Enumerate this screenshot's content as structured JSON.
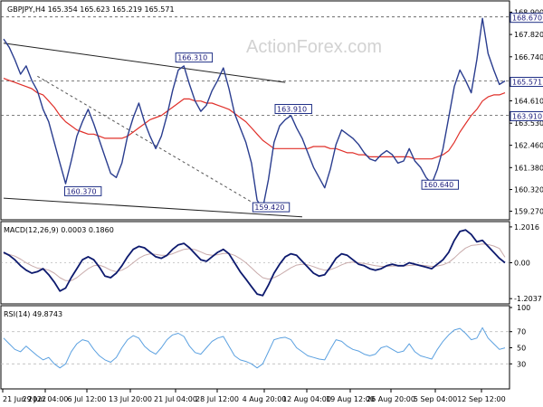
{
  "colors": {
    "bg": "#ffffff",
    "price": "#2a3d8f",
    "ma": "#e0302a",
    "macd": "#0d1a6e",
    "signal": "#c8aaaa",
    "rsi": "#5aa0e0",
    "grid": "#bdbdbd",
    "label_border": "#1f2f86",
    "watermark": "#d2d2d2"
  },
  "chart_data": [
    {
      "type": "line",
      "title": "GBPJPY,H4  165.354 165.623 165.219 165.571",
      "watermark": "ActionForex.com",
      "ylim": [
        158.9,
        169.4
      ],
      "yticks": [
        "168.900",
        "167.820",
        "166.740",
        "165.571",
        "164.610",
        "163.530",
        "162.460",
        "161.380",
        "160.320",
        "159.270"
      ],
      "key_levels": [
        "168.670",
        "165.571",
        "163.910"
      ],
      "series": [
        {
          "values": [
            167.6,
            167.2,
            166.6,
            165.9,
            166.3,
            165.6,
            165.1,
            164.2,
            163.6,
            162.6,
            161.6,
            160.6,
            161.7,
            162.9,
            163.6,
            164.2,
            163.5,
            162.7,
            161.9,
            161.1,
            160.9,
            161.6,
            162.9,
            163.8,
            164.5,
            163.6,
            162.9,
            162.3,
            162.9,
            163.9,
            165.1,
            166.1,
            166.3,
            165.4,
            164.6,
            164.1,
            164.4,
            165.1,
            165.6,
            166.2,
            165.2,
            164.0,
            163.3,
            162.6,
            161.6,
            159.8,
            159.4,
            160.8,
            162.6,
            163.4,
            163.7,
            163.9,
            163.3,
            162.8,
            162.1,
            161.4,
            160.9,
            160.4,
            161.3,
            162.5,
            163.2,
            163.0,
            162.8,
            162.5,
            162.1,
            161.8,
            161.7,
            162.0,
            162.2,
            162.0,
            161.6,
            161.7,
            162.3,
            161.7,
            161.4,
            160.9,
            160.6,
            161.3,
            162.3,
            163.8,
            165.3,
            166.1,
            165.6,
            165.0,
            166.6,
            168.6,
            166.9,
            166.1,
            165.4,
            165.571
          ],
          "labels": [
            "166.310",
            "163.910",
            "160.370",
            "159.420",
            "160.640"
          ]
        },
        {
          "name": "MA",
          "values": [
            165.7,
            165.6,
            165.5,
            165.4,
            165.3,
            165.2,
            165.0,
            164.9,
            164.6,
            164.3,
            163.9,
            163.6,
            163.4,
            163.2,
            163.1,
            163.0,
            163.0,
            162.9,
            162.8,
            162.8,
            162.8,
            162.8,
            162.9,
            163.1,
            163.3,
            163.5,
            163.7,
            163.8,
            163.9,
            164.1,
            164.3,
            164.5,
            164.7,
            164.7,
            164.6,
            164.6,
            164.5,
            164.5,
            164.4,
            164.3,
            164.2,
            164.0,
            163.8,
            163.6,
            163.3,
            163.0,
            162.7,
            162.5,
            162.3,
            162.3,
            162.3,
            162.3,
            162.3,
            162.3,
            162.3,
            162.4,
            162.4,
            162.4,
            162.3,
            162.3,
            162.2,
            162.1,
            162.1,
            162.0,
            162.0,
            161.9,
            161.9,
            161.9,
            161.9,
            161.9,
            161.9,
            161.9,
            161.9,
            161.8,
            161.8,
            161.8,
            161.8,
            161.9,
            162.0,
            162.2,
            162.6,
            163.1,
            163.5,
            163.9,
            164.2,
            164.6,
            164.8,
            164.9,
            164.9,
            165.0
          ]
        }
      ],
      "trendlines": [
        {
          "from": [
            0,
            167.4
          ],
          "to": [
            50,
            165.5
          ]
        },
        {
          "from": [
            0,
            159.9
          ],
          "to": [
            53,
            159.0
          ]
        },
        {
          "from": [
            6,
            165.8
          ],
          "to": [
            46,
            159.4
          ],
          "dashed": true
        }
      ],
      "x_tick_labels": [
        "21 Jun 2022",
        "29 Jun 04:00",
        "6 Jul 12:00",
        "13 Jul 20:00",
        "21 Jul 04:00",
        "28 Jul 12:00",
        "4 Aug 20:00",
        "12 Aug 04:00",
        "19 Aug 12:00",
        "26 Aug 20:00",
        "5 Sep 04:00",
        "12 Sep 12:00"
      ]
    },
    {
      "type": "line",
      "title": "MACD(12,26,9) 0.0003 0.1860",
      "ylim": [
        -1.35,
        1.35
      ],
      "yticks": [
        "1.2016",
        "0.00",
        "-1.2037"
      ],
      "series": [
        {
          "name": "MACD",
          "values": [
            0.35,
            0.25,
            0.1,
            -0.1,
            -0.25,
            -0.35,
            -0.3,
            -0.2,
            -0.4,
            -0.65,
            -0.95,
            -0.85,
            -0.5,
            -0.2,
            0.1,
            0.2,
            0.1,
            -0.15,
            -0.45,
            -0.5,
            -0.35,
            -0.1,
            0.2,
            0.45,
            0.55,
            0.5,
            0.35,
            0.2,
            0.15,
            0.25,
            0.45,
            0.6,
            0.65,
            0.5,
            0.3,
            0.1,
            0.05,
            0.2,
            0.35,
            0.45,
            0.3,
            0.0,
            -0.3,
            -0.55,
            -0.8,
            -1.05,
            -1.1,
            -0.75,
            -0.35,
            -0.05,
            0.2,
            0.3,
            0.25,
            0.05,
            -0.15,
            -0.35,
            -0.45,
            -0.4,
            -0.15,
            0.15,
            0.3,
            0.25,
            0.1,
            -0.05,
            -0.1,
            -0.2,
            -0.25,
            -0.2,
            -0.1,
            -0.05,
            -0.1,
            -0.1,
            0.0,
            -0.05,
            -0.1,
            -0.15,
            -0.2,
            -0.05,
            0.1,
            0.35,
            0.75,
            1.05,
            1.1,
            0.95,
            0.7,
            0.75,
            0.55,
            0.35,
            0.15,
            0.0003
          ]
        },
        {
          "name": "Signal",
          "values": [
            0.3,
            0.28,
            0.22,
            0.12,
            0.0,
            -0.1,
            -0.18,
            -0.2,
            -0.25,
            -0.35,
            -0.5,
            -0.6,
            -0.6,
            -0.5,
            -0.35,
            -0.2,
            -0.1,
            -0.08,
            -0.15,
            -0.25,
            -0.3,
            -0.25,
            -0.15,
            0.0,
            0.15,
            0.25,
            0.3,
            0.28,
            0.25,
            0.25,
            0.3,
            0.38,
            0.45,
            0.47,
            0.44,
            0.36,
            0.28,
            0.25,
            0.27,
            0.31,
            0.31,
            0.25,
            0.14,
            0.0,
            -0.17,
            -0.35,
            -0.5,
            -0.55,
            -0.5,
            -0.41,
            -0.29,
            -0.17,
            -0.08,
            -0.05,
            -0.07,
            -0.13,
            -0.2,
            -0.25,
            -0.23,
            -0.16,
            -0.07,
            0.0,
            0.02,
            0.0,
            -0.02,
            -0.06,
            -0.1,
            -0.12,
            -0.12,
            -0.11,
            -0.11,
            -0.11,
            -0.09,
            -0.08,
            -0.08,
            -0.1,
            -0.12,
            -0.11,
            -0.07,
            0.01,
            0.16,
            0.34,
            0.49,
            0.58,
            0.6,
            0.63,
            0.61,
            0.56,
            0.48,
            0.186
          ]
        }
      ]
    },
    {
      "type": "line",
      "title": "RSI(14) 49.8743",
      "ylim": [
        0,
        100
      ],
      "yticks": [
        "100",
        "70",
        "50",
        "30"
      ],
      "series": [
        {
          "name": "RSI",
          "values": [
            62,
            55,
            48,
            45,
            52,
            46,
            40,
            35,
            38,
            30,
            25,
            30,
            45,
            55,
            60,
            58,
            48,
            40,
            35,
            32,
            38,
            50,
            60,
            65,
            62,
            52,
            46,
            42,
            50,
            60,
            66,
            68,
            64,
            52,
            44,
            42,
            50,
            58,
            62,
            64,
            52,
            40,
            35,
            33,
            30,
            25,
            30,
            45,
            60,
            62,
            63,
            60,
            50,
            45,
            40,
            38,
            36,
            35,
            48,
            60,
            58,
            52,
            48,
            46,
            42,
            40,
            42,
            50,
            52,
            48,
            44,
            46,
            55,
            45,
            40,
            38,
            36,
            48,
            58,
            66,
            72,
            74,
            68,
            60,
            62,
            75,
            62,
            55,
            48,
            49.87
          ]
        }
      ]
    }
  ]
}
